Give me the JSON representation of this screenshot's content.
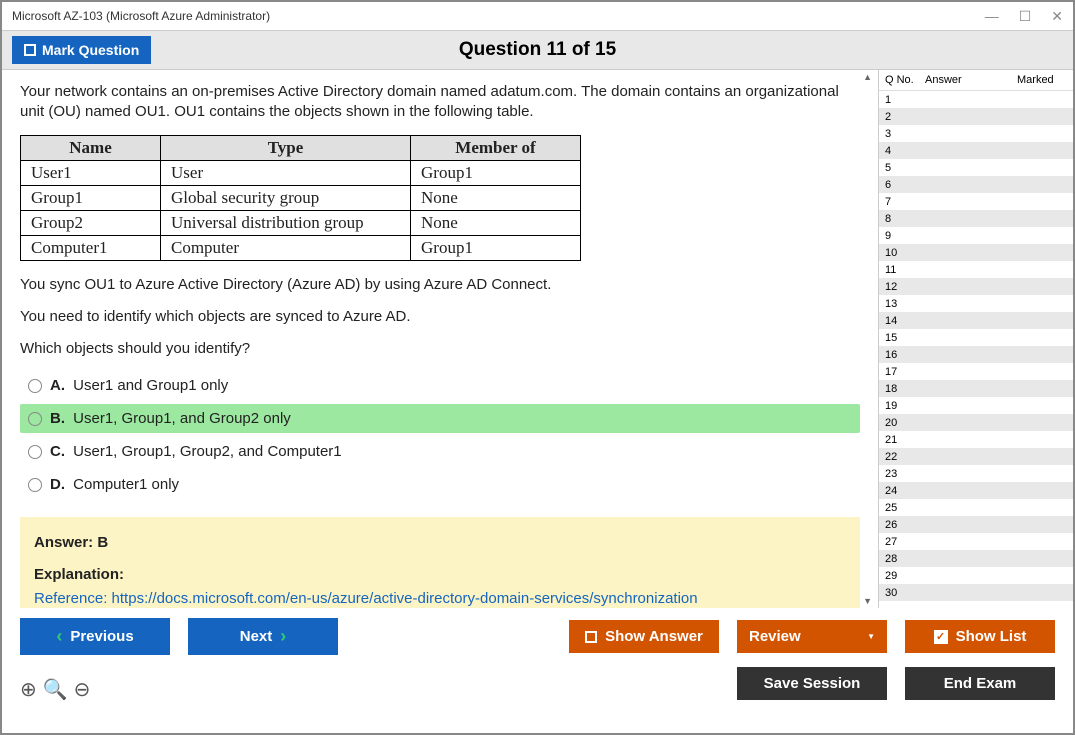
{
  "window": {
    "title": "Microsoft AZ-103 (Microsoft Azure Administrator)"
  },
  "toolbar": {
    "mark": "Mark Question",
    "title": "Question 11 of 15"
  },
  "question": {
    "p1": "Your network contains an on-premises Active Directory domain named adatum.com. The domain contains an organizational unit (OU) named OU1. OU1 contains the objects shown in the following table.",
    "table": {
      "h1": "Name",
      "h2": "Type",
      "h3": "Member of",
      "rows": [
        {
          "c1": "User1",
          "c2": "User",
          "c3": "Group1"
        },
        {
          "c1": "Group1",
          "c2": "Global security group",
          "c3": "None"
        },
        {
          "c1": "Group2",
          "c2": "Universal distribution group",
          "c3": "None"
        },
        {
          "c1": "Computer1",
          "c2": "Computer",
          "c3": "Group1"
        }
      ]
    },
    "p2": "You sync OU1 to Azure Active Directory (Azure AD) by using Azure AD Connect.",
    "p3": "You need to identify which objects are synced to Azure AD.",
    "p4": "Which objects should you identify?",
    "options": [
      {
        "letter": "A.",
        "text": "User1 and Group1 only",
        "selected": false
      },
      {
        "letter": "B.",
        "text": "User1, Group1, and Group2 only",
        "selected": true
      },
      {
        "letter": "C.",
        "text": "User1, Group1, Group2, and Computer1",
        "selected": false
      },
      {
        "letter": "D.",
        "text": "Computer1 only",
        "selected": false
      }
    ],
    "answer_label": "Answer: B",
    "explanation_label": "Explanation:",
    "reference_prefix": "Reference: ",
    "reference_link": "https://docs.microsoft.com/en-us/azure/active-directory-domain-services/synchronization"
  },
  "sidebar": {
    "headers": {
      "qno": "Q No.",
      "answer": "Answer",
      "marked": "Marked"
    },
    "count": 30
  },
  "buttons": {
    "previous": "Previous",
    "next": "Next",
    "show_answer": "Show Answer",
    "review": "Review",
    "show_list": "Show List",
    "save_session": "Save Session",
    "end_exam": "End Exam"
  }
}
